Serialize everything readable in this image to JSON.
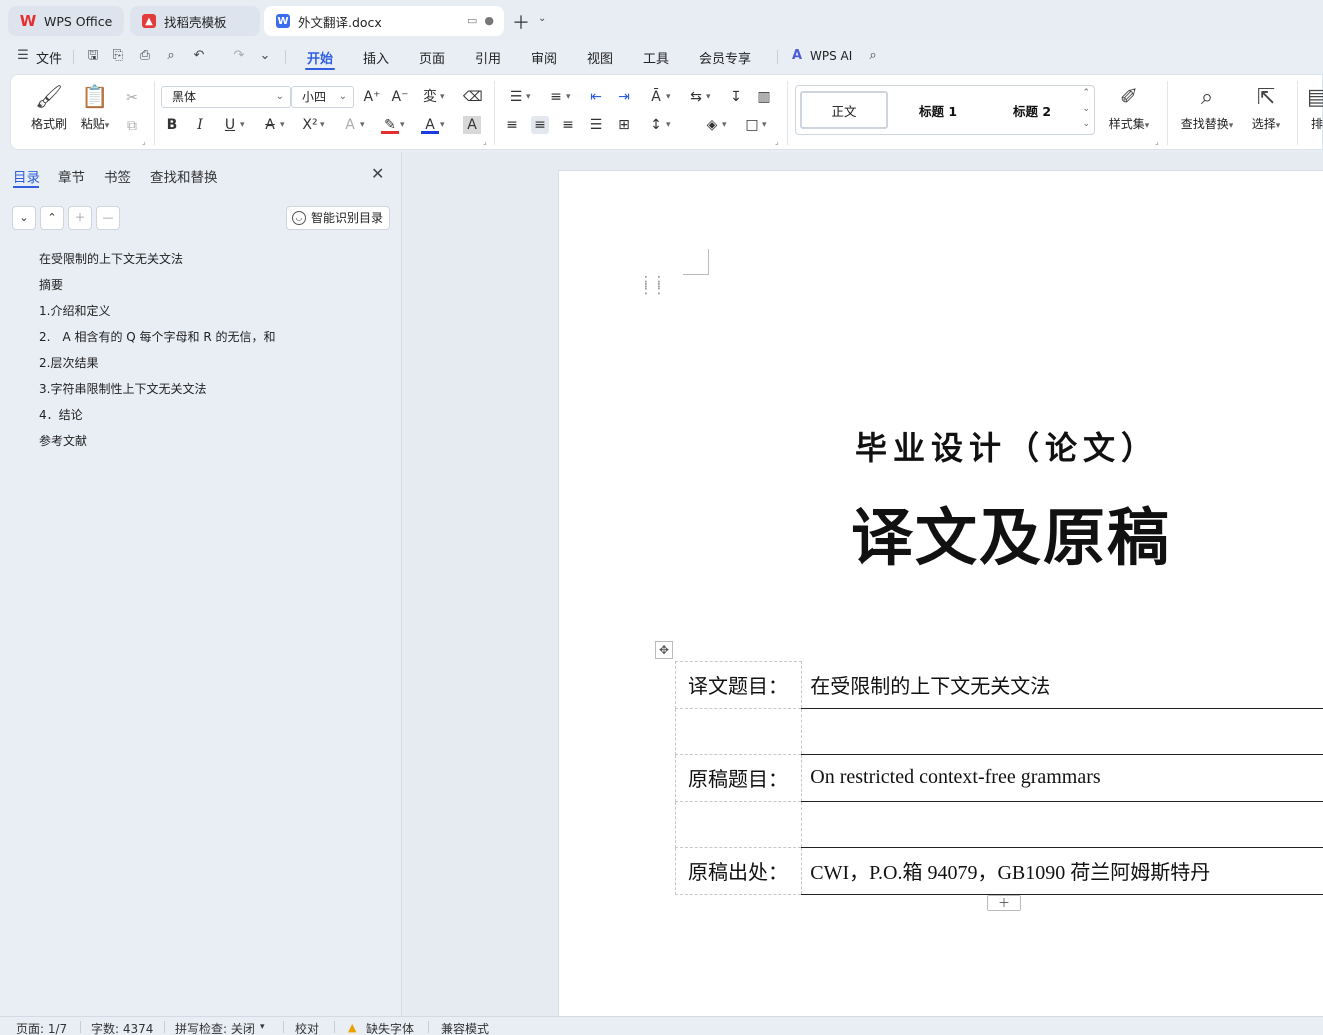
{
  "tabs": [
    {
      "label": "WPS Office"
    },
    {
      "label": "找稻壳模板"
    },
    {
      "label": "外文翻译.docx"
    }
  ],
  "menu": {
    "file": "文件",
    "items": [
      "开始",
      "插入",
      "页面",
      "引用",
      "审阅",
      "视图",
      "工具",
      "会员专享"
    ],
    "wps_ai": "WPS AI"
  },
  "ribbon": {
    "format_painter": "格式刷",
    "paste": "粘贴",
    "font_name": "黑体",
    "font_size": "小四",
    "styles": [
      "正文",
      "标题 1",
      "标题 2"
    ],
    "style_set": "样式集",
    "find_replace": "查找替换",
    "select": "选择",
    "layout": "排"
  },
  "nav": {
    "tabs": [
      "目录",
      "章节",
      "书签",
      "查找和替换"
    ],
    "smart_toc": "智能识别目录",
    "toc": [
      "在受限制的上下文无关文法",
      "摘要",
      "1.介绍和定义",
      "2.　A 相含有的 Q 每个字母和 R 的无信，和",
      "2.层次结果",
      "3.字符串限制性上下文无关文法",
      "4．结论",
      "参考文献"
    ]
  },
  "document": {
    "subtitle": "毕业设计（论文）",
    "title": "译文及原稿",
    "table": [
      {
        "label": "译文题目：",
        "value": "在受限制的上下文无关文法"
      },
      {
        "label": "",
        "value": ""
      },
      {
        "label": "原稿题目：",
        "value": "On restricted context-free grammars"
      },
      {
        "label": "",
        "value": ""
      },
      {
        "label": "原稿出处：",
        "value": "CWI，P.O.箱 94079，GB1090 荷兰阿姆斯特丹"
      }
    ]
  },
  "status": {
    "page": "页面: 1/7",
    "words": "字数: 4374",
    "spell": "拼写检查: 关闭",
    "proof": "校对",
    "missing_font": "缺失字体",
    "compat": "兼容模式"
  },
  "colors": {
    "accent": "#2f5fe0",
    "wps_red": "#e52e2e"
  }
}
